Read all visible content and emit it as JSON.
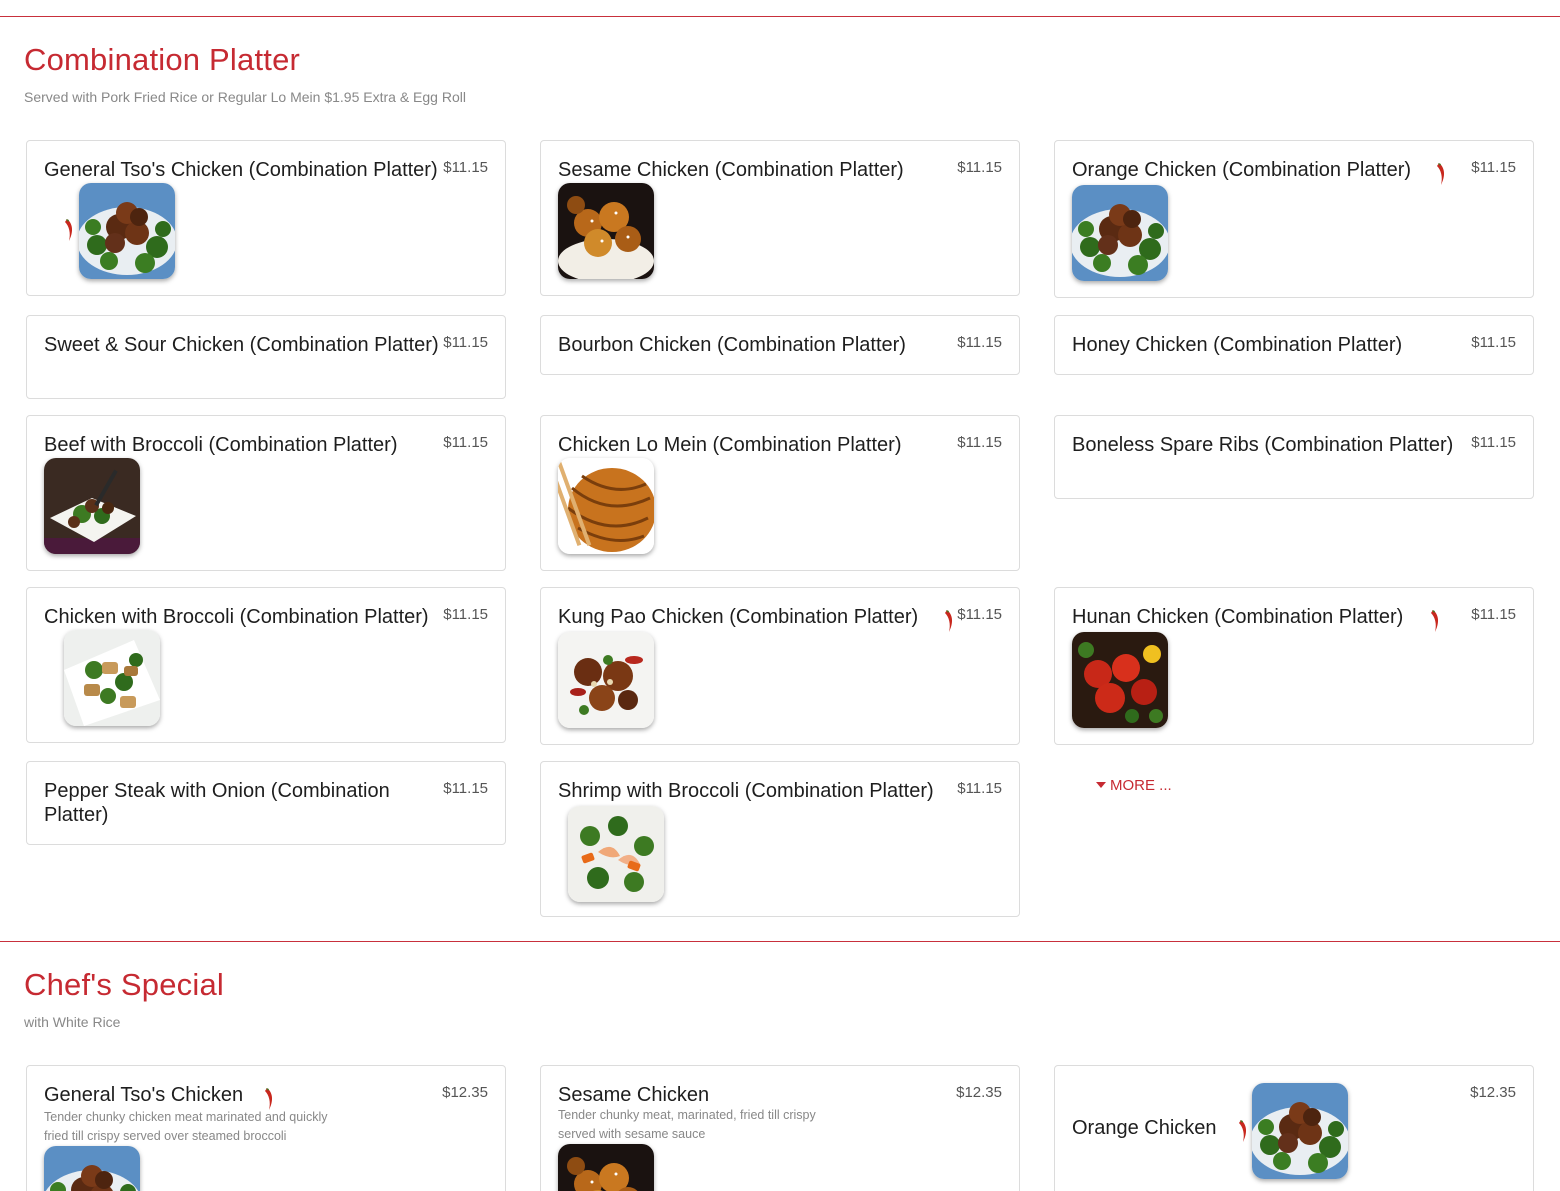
{
  "sections": [
    {
      "title": "Combination Platter",
      "subtitle": "Served with Pork Fried Rice or Regular Lo Mein $1.95 Extra & Egg Roll",
      "items": [
        {
          "name": "General Tso's Chicken (Combination Platter)",
          "price": "$11.15",
          "spicy": true,
          "image": "chicken-broccoli-plate-image"
        },
        {
          "name": "Sesame Chicken (Combination Platter)",
          "price": "$11.15",
          "spicy": false,
          "image": "sesame-chicken-image"
        },
        {
          "name": "Orange Chicken (Combination Platter)",
          "price": "$11.15",
          "spicy": true,
          "image": "chicken-broccoli-plate-image"
        },
        {
          "name": "Sweet & Sour Chicken (Combination Platter)",
          "price": "$11.15",
          "spicy": false
        },
        {
          "name": "Bourbon Chicken (Combination Platter)",
          "price": "$11.15",
          "spicy": false
        },
        {
          "name": "Honey Chicken (Combination Platter)",
          "price": "$11.15",
          "spicy": false
        },
        {
          "name": "Beef with Broccoli (Combination Platter)",
          "price": "$11.15",
          "spicy": false,
          "image": "beef-broccoli-image"
        },
        {
          "name": "Chicken Lo Mein (Combination Platter)",
          "price": "$11.15",
          "spicy": false,
          "image": "lo-mein-image"
        },
        {
          "name": "Boneless Spare Ribs (Combination Platter)",
          "price": "$11.15",
          "spicy": false
        },
        {
          "name": "Chicken with Broccoli (Combination Platter)",
          "price": "$11.15",
          "spicy": false,
          "image": "chicken-broccoli-image"
        },
        {
          "name": "Kung Pao Chicken (Combination Platter)",
          "price": "$11.15",
          "spicy": true,
          "image": "kung-pao-image"
        },
        {
          "name": "Hunan Chicken (Combination Platter)",
          "price": "$11.15",
          "spicy": true,
          "image": "hunan-chicken-image"
        },
        {
          "name": "Pepper Steak with Onion (Combination Platter)",
          "price": "$11.15",
          "spicy": false
        },
        {
          "name": "Shrimp with Broccoli (Combination Platter)",
          "price": "$11.15",
          "spicy": false,
          "image": "shrimp-broccoli-image"
        }
      ],
      "more_label": "MORE ..."
    },
    {
      "title": "Chef's Special",
      "subtitle": "with White Rice",
      "items": [
        {
          "name": "General Tso's Chicken",
          "price": "$12.35",
          "spicy": true,
          "description": "Tender chunky chicken meat marinated and quickly fried till crispy served over steamed broccoli",
          "image": "chicken-broccoli-plate-image"
        },
        {
          "name": "Sesame Chicken",
          "price": "$12.35",
          "spicy": false,
          "description": "Tender chunky meat, marinated, fried till crispy served with sesame sauce",
          "image": "sesame-chicken-image"
        },
        {
          "name": "Orange Chicken",
          "price": "$12.35",
          "spicy": true,
          "image": "chicken-broccoli-plate-image"
        }
      ]
    }
  ],
  "colors": {
    "accent": "#c62a32",
    "border": "#dcdcdc",
    "muted": "#888888"
  }
}
